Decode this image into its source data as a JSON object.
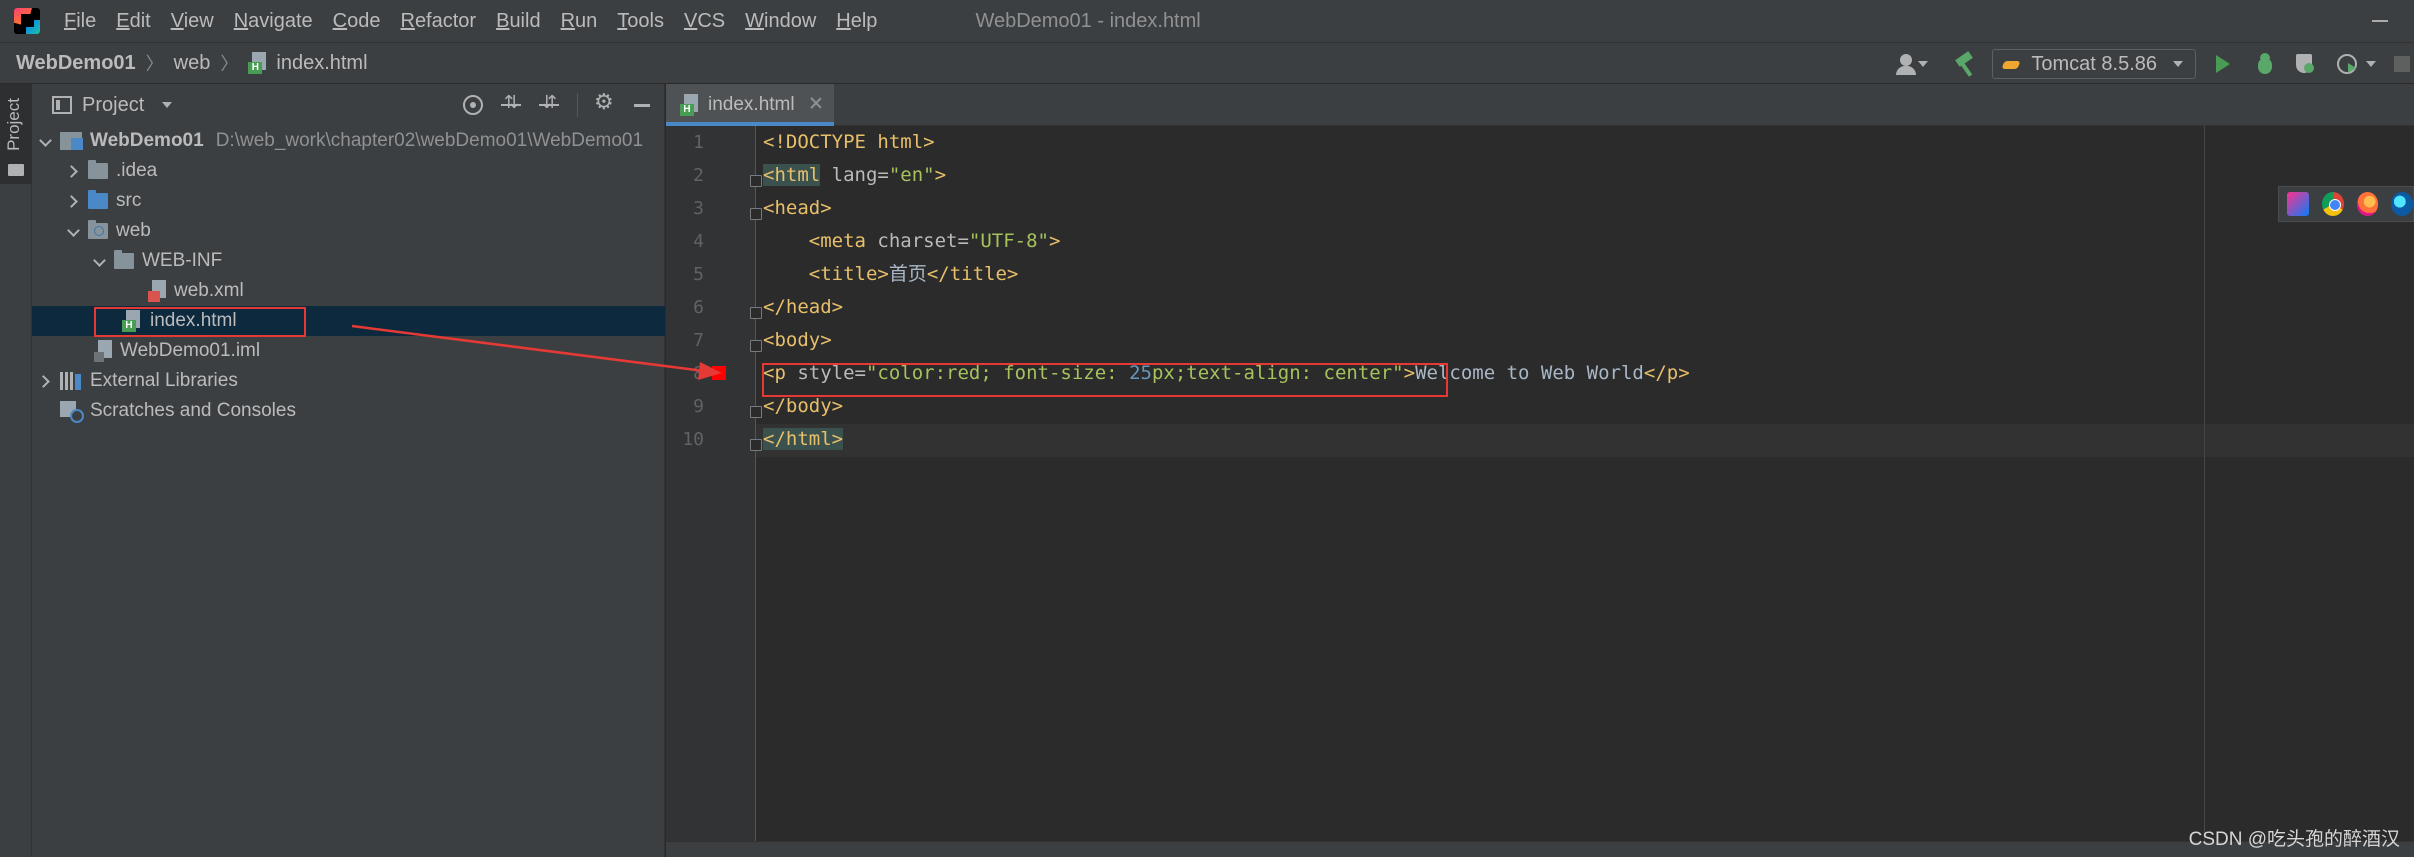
{
  "menu": {
    "items": [
      {
        "mnemonic": "F",
        "rest": "ile"
      },
      {
        "mnemonic": "E",
        "rest": "dit"
      },
      {
        "mnemonic": "V",
        "rest": "iew"
      },
      {
        "mnemonic": "N",
        "rest": "avigate"
      },
      {
        "mnemonic": "C",
        "rest": "ode"
      },
      {
        "mnemonic": "R",
        "rest": "efactor"
      },
      {
        "mnemonic": "B",
        "rest": "uild"
      },
      {
        "mnemonic": "R",
        "rest": "un"
      },
      {
        "mnemonic": "T",
        "rest": "ools"
      },
      {
        "mnemonic": "V",
        "rest": "CS"
      },
      {
        "mnemonic": "W",
        "rest": "indow"
      },
      {
        "mnemonic": "H",
        "rest": "elp"
      }
    ],
    "window_title": "WebDemo01 - index.html"
  },
  "navbar": {
    "breadcrumbs": [
      "WebDemo01",
      "web",
      "index.html"
    ],
    "run_config": "Tomcat 8.5.86"
  },
  "tool_strip": {
    "project_label": "Project"
  },
  "project_panel": {
    "title": "Project",
    "tree": [
      {
        "label": "WebDemo01",
        "path": "D:\\web_work\\chapter02\\webDemo01\\WebDemo01"
      },
      {
        "label": ".idea"
      },
      {
        "label": "src"
      },
      {
        "label": "web"
      },
      {
        "label": "WEB-INF"
      },
      {
        "label": "web.xml"
      },
      {
        "label": "index.html"
      },
      {
        "label": "WebDemo01.iml"
      },
      {
        "label": "External Libraries"
      },
      {
        "label": "Scratches and Consoles"
      }
    ]
  },
  "editor": {
    "tab_label": "index.html",
    "line_numbers": [
      "1",
      "2",
      "3",
      "4",
      "5",
      "6",
      "7",
      "8",
      "9",
      "10"
    ],
    "code": {
      "l1": "<!DOCTYPE html>",
      "l2_open": "<html",
      "l2_attr": " lang=",
      "l2_val": "\"en\"",
      "l2_close": ">",
      "l3": "<head>",
      "l4_indent": "    ",
      "l4_open": "<meta",
      "l4_attr": " charset=",
      "l4_val": "\"UTF-8\"",
      "l4_close": ">",
      "l5_indent": "    ",
      "l5_open": "<title>",
      "l5_text": "首页",
      "l5_close": "</title>",
      "l6": "</head>",
      "l7": "<body>",
      "l8_open": "<p",
      "l8_attr": " style=",
      "l8_val1": "\"color:red; font-size: ",
      "l8_num": "25",
      "l8_val2": "px;text-align: center\"",
      "l8_gt": ">",
      "l8_text": "Welcome to Web World",
      "l8_close": "</p>",
      "l9": "</body>",
      "l10": "</html>"
    }
  },
  "watermark": "CSDN @吃头孢的醉酒汉",
  "colors": {
    "highlight_box": "#e53935",
    "accent": "#4a88c7",
    "run_green": "#499c54"
  }
}
